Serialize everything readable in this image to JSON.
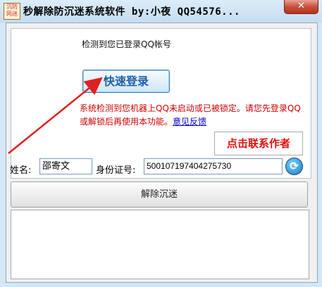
{
  "window": {
    "title": "秒解除防沉迷系统软件 by:小夜   QQ54576...",
    "close_symbol": "✕",
    "icon_text": "沉防 网迷"
  },
  "main": {
    "detect_label": "检测到您已登录QQ帐号",
    "login_button": "快速登录",
    "warning_text": "系统检测到您机器上QQ未启动或已被锁定。请您先登录QQ或解锁后再使用本功能。",
    "feedback_link": "意见反馈",
    "contact_label": "点击联系作者"
  },
  "form": {
    "name_label": "姓名:",
    "name_value": "邵寄文",
    "id_label": "身份证号:",
    "id_value": "500107197404275730",
    "refresh_symbol": "⟳"
  },
  "actions": {
    "unlock_button": "解除沉迷"
  },
  "colors": {
    "accent": "#1e5fa8",
    "warning": "#d00000",
    "arrow": "#e02020"
  }
}
